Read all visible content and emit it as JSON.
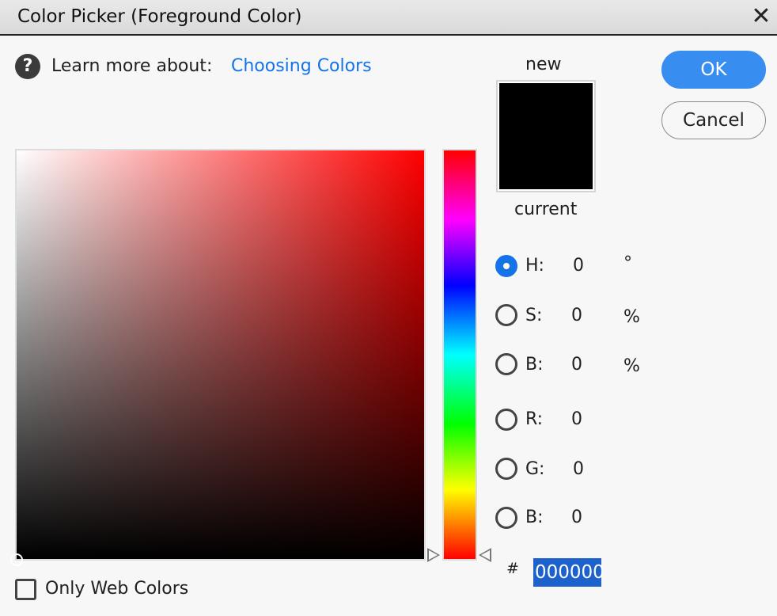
{
  "window": {
    "title": "Color Picker (Foreground Color)",
    "close_icon": "close-icon"
  },
  "help": {
    "icon": "help-icon",
    "text": "Learn more about:",
    "link": "Choosing Colors"
  },
  "preview": {
    "new_label": "new",
    "current_label": "current",
    "new_color": "#000000",
    "current_color": "#000000"
  },
  "buttons": {
    "ok": "OK",
    "cancel": "Cancel"
  },
  "fields": [
    {
      "label": "H:",
      "value": "0",
      "unit": "°",
      "selected": true
    },
    {
      "label": "S:",
      "value": "0",
      "unit": "%",
      "selected": false
    },
    {
      "label": "B:",
      "value": "0",
      "unit": "%",
      "selected": false
    },
    {
      "label": "R:",
      "value": "0",
      "unit": "",
      "selected": false
    },
    {
      "label": "G:",
      "value": "0",
      "unit": "",
      "selected": false
    },
    {
      "label": "B:",
      "value": "0",
      "unit": "",
      "selected": false
    }
  ],
  "hex": {
    "prefix": "#",
    "value": "000000"
  },
  "web_colors": {
    "label": "Only Web Colors",
    "checked": false
  },
  "colors": {
    "accent": "#1473e6",
    "ok_button": "#378ef0",
    "hex_highlight": "#1d62cc",
    "field_hue": "#ff0000"
  }
}
